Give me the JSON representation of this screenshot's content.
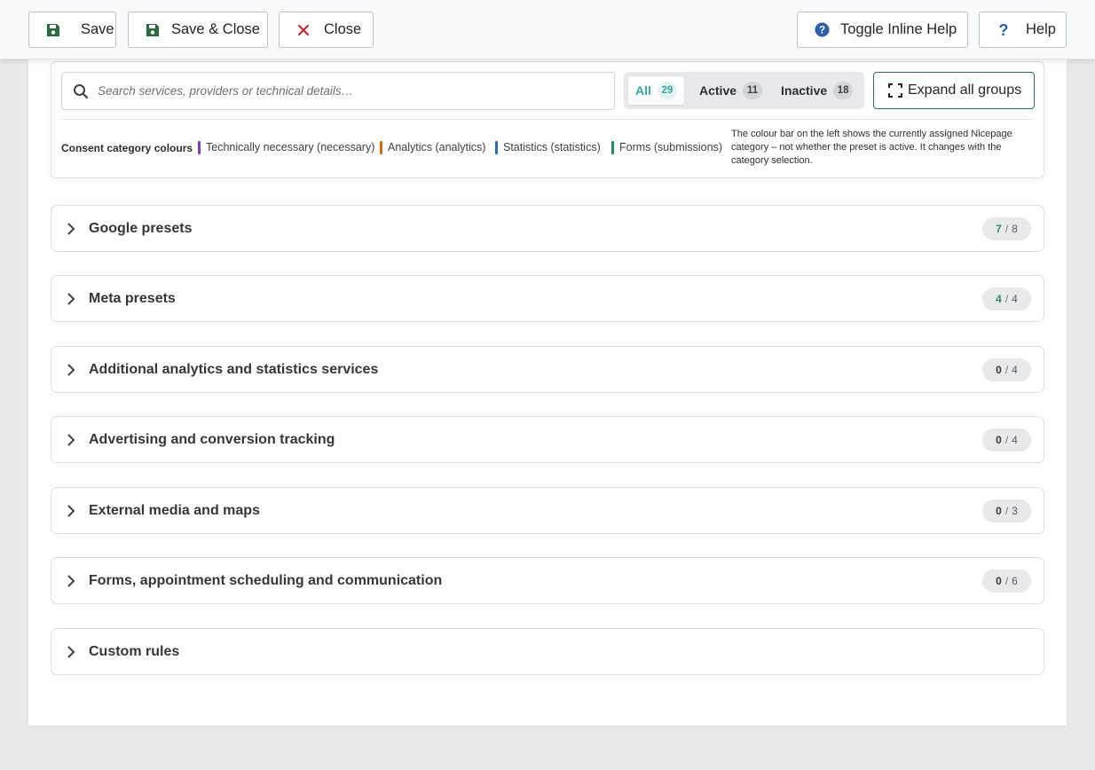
{
  "toolbar": {
    "save_label": "Save",
    "save_close_label": "Save & Close",
    "close_label": "Close",
    "toggle_help_label": "Toggle Inline Help",
    "help_label": "Help",
    "icons": {
      "save": "floppy-disk-icon",
      "close": "x-icon",
      "toggle_help": "question-circle-icon",
      "help": "question-mark-icon"
    },
    "colors": {
      "save_icon": "#2c6b3f",
      "close_icon": "#c8202a",
      "help_icon": "#2d5fa8"
    }
  },
  "filter": {
    "search_placeholder": "Search services, providers or technical details…",
    "segments": [
      {
        "label": "All",
        "count": "29",
        "active": true
      },
      {
        "label": "Active",
        "count": "11",
        "active": false
      },
      {
        "label": "Inactive",
        "count": "18",
        "active": false
      }
    ],
    "expand_label": "Expand all groups",
    "accent_color": "#3aa89a"
  },
  "legend": {
    "title": "Consent category colours",
    "items": [
      {
        "label": "Technically necessary (necessary)",
        "color": "#7b3fc4"
      },
      {
        "label": "Analytics (analytics)",
        "color": "#d66a12"
      },
      {
        "label": "Statistics (statistics)",
        "color": "#2a6fb5"
      },
      {
        "label": "Forms (submissions)",
        "color": "#1f8a66"
      }
    ],
    "note": "The colour bar on the left shows the currently assigned Nicepage category – not whether the preset is active. It changes with the category selection."
  },
  "groups": [
    {
      "title": "Google presets",
      "active": "7",
      "total": "8"
    },
    {
      "title": "Meta presets",
      "active": "4",
      "total": "4"
    },
    {
      "title": "Additional analytics and statistics services",
      "active": "0",
      "total": "4"
    },
    {
      "title": "Advertising and conversion tracking",
      "active": "0",
      "total": "4"
    },
    {
      "title": "External media and maps",
      "active": "0",
      "total": "3"
    },
    {
      "title": "Forms, appointment scheduling and communication",
      "active": "0",
      "total": "6"
    },
    {
      "title": "Custom rules",
      "active": "",
      "total": ""
    }
  ]
}
